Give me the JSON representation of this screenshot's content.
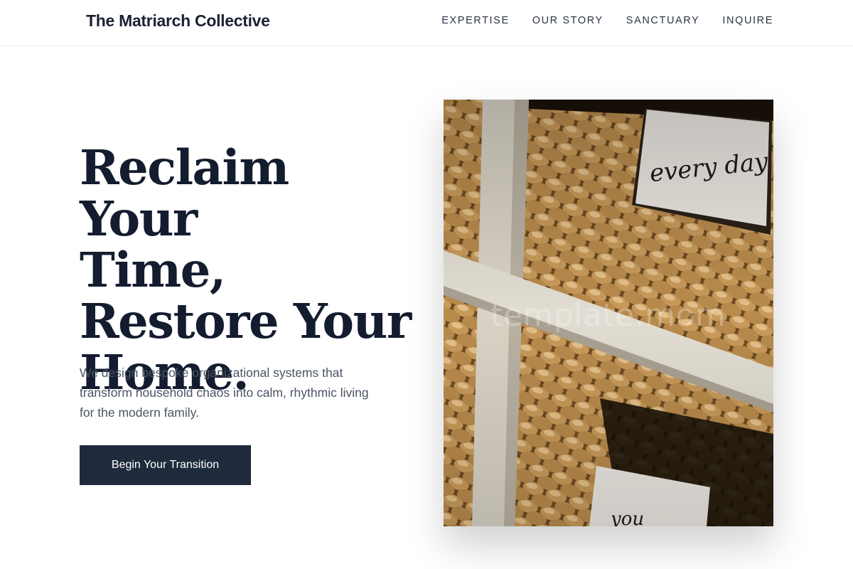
{
  "header": {
    "brand": "The Matriarch Collective",
    "nav": [
      "EXPERTISE",
      "OUR STORY",
      "SANCTUARY",
      "INQUIRE"
    ]
  },
  "hero": {
    "title_lines": [
      "Reclaim Your",
      "Time,",
      "Restore Your",
      "Home."
    ],
    "description": "We design bespoke organizational systems that transform household chaos into calm, rhythmic living for the modern family.",
    "cta_label": "Begin Your Transition"
  },
  "image": {
    "subject": "woven baskets on white shelves with labels",
    "label_top": "every day",
    "label_bottom": "you",
    "watermark": "template.mom"
  },
  "colors": {
    "brand_text": "#1a2233",
    "heading": "#141c2f",
    "body_text": "#4b5565",
    "button_bg": "#1f2a3d",
    "button_text": "#ffffff"
  }
}
